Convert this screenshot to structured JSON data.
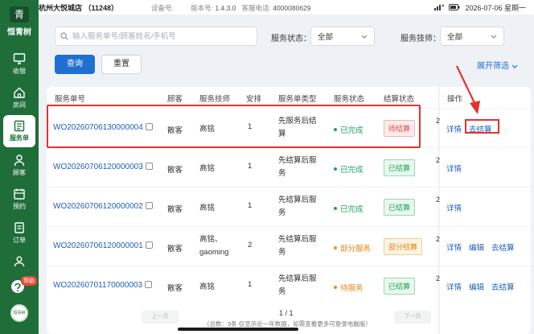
{
  "statusbar": {
    "store": "杭州大悦城店  （11248）",
    "device_label": "设备号:",
    "version_label": "版本号:",
    "version": "1.4.3.0",
    "hotline_label": "客服电话:",
    "hotline": "4000080629",
    "datetime": "2026-07-06 星期一"
  },
  "sidebar": {
    "brand": "恒青树",
    "brand_mark": "青",
    "items": [
      {
        "label": "收银"
      },
      {
        "label": "房间"
      },
      {
        "label": "服务单"
      },
      {
        "label": "顾客"
      },
      {
        "label": "预约"
      },
      {
        "label": "订单"
      },
      {
        "label": "员工"
      }
    ],
    "help": "帮助",
    "avatar_text": "恒青树"
  },
  "filters": {
    "search_placeholder": "输入服务单号/顾客姓名/手机号",
    "status_label": "服务状态：",
    "status_value": "全部",
    "tech_label": "服务技师：",
    "tech_value": "全部",
    "query": "查询",
    "reset": "重置",
    "expand": "展开筛选"
  },
  "table": {
    "headers": [
      "服务单号",
      "顾客",
      "服务技师",
      "安排",
      "服务单类型",
      "服务状态",
      "结算状态",
      "操作"
    ],
    "rows": [
      {
        "order_no": "WO20260706130000004",
        "customer": "散客",
        "tech": "高铭",
        "tech2": "",
        "count": "1",
        "type1": "先服务后结",
        "type2": "算",
        "status": "已完成",
        "pay": "待结算",
        "clip": "2",
        "ops": [
          "详情",
          "去结算"
        ]
      },
      {
        "order_no": "WO20260706120000003",
        "customer": "散客",
        "tech": "高铭",
        "tech2": "",
        "count": "1",
        "type1": "先结算后服",
        "type2": "务",
        "status": "已完成",
        "pay": "已结算",
        "clip": "2",
        "ops": [
          "详情"
        ]
      },
      {
        "order_no": "WO20260706120000002",
        "customer": "散客",
        "tech": "高铭",
        "tech2": "",
        "count": "1",
        "type1": "先结算后服",
        "type2": "务",
        "status": "已完成",
        "pay": "已结算",
        "clip": "2",
        "ops": [
          "详情"
        ]
      },
      {
        "order_no": "WO20260706120000001",
        "customer": "散客",
        "tech": "高铭、",
        "tech2": "gaoming",
        "count": "2",
        "type1": "先结算后服",
        "type2": "务",
        "status": "部分服务",
        "pay": "部分结算",
        "clip": "2",
        "ops": [
          "详情",
          "编辑",
          "去结算"
        ]
      },
      {
        "order_no": "WO20260701170000003",
        "customer": "散客",
        "tech": "高铭",
        "tech2": "",
        "count": "1",
        "type1": "先结算后服",
        "type2": "务",
        "status": "待服务",
        "pay": "已结算",
        "clip": "2",
        "ops": [
          "详情",
          "编辑",
          "去结算"
        ]
      }
    ]
  },
  "pager": {
    "prev": "上一页",
    "next": "下一页",
    "page": "1 / 1",
    "note": "（总数：9条 仅显示近一年数据，如需查看更多可登录电脑版）"
  },
  "colors": {
    "sidebar": "#1f6e3a",
    "primary": "#1f6fd1",
    "highlight": "#e5312e"
  }
}
